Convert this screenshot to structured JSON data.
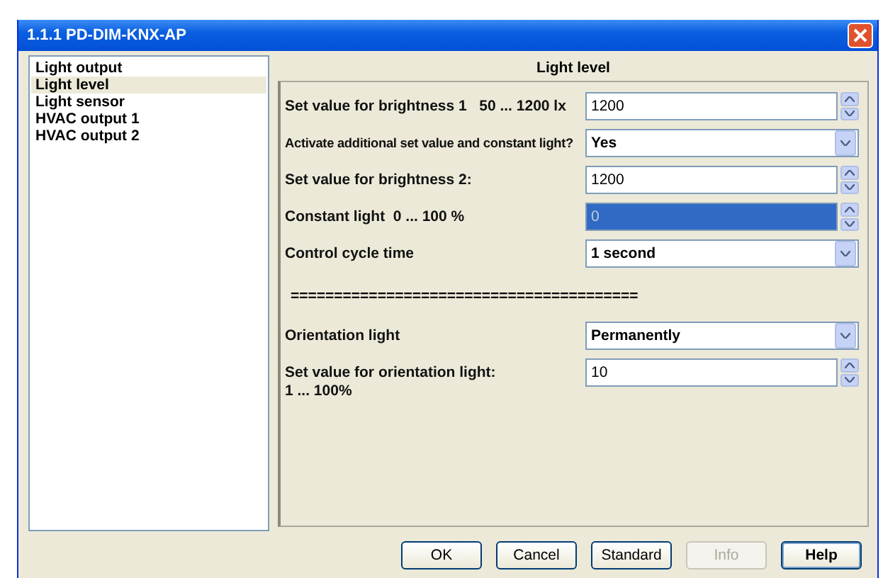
{
  "window": {
    "title": "1.1.1 PD-DIM-KNX-AP"
  },
  "sidebar": {
    "items": [
      {
        "label": "Light output",
        "selected": false
      },
      {
        "label": "Light level",
        "selected": true
      },
      {
        "label": "Light sensor",
        "selected": false
      },
      {
        "label": "HVAC output 1",
        "selected": false
      },
      {
        "label": "HVAC output 2",
        "selected": false
      }
    ]
  },
  "panel": {
    "title": "Light level",
    "parameters": [
      {
        "kind": "spin",
        "label": "Set value for brightness 1   50 ... 1200 lx",
        "value": "1200",
        "selected": false
      },
      {
        "kind": "dropdown",
        "label": "Activate additional set value and constant light?",
        "value": "Yes",
        "selected": false
      },
      {
        "kind": "spin",
        "label": "Set value for brightness 2:",
        "value": "1200",
        "selected": false
      },
      {
        "kind": "spin",
        "label": "Constant light  0 ... 100 %",
        "value": "0",
        "selected": true
      },
      {
        "kind": "dropdown",
        "label": "Control cycle time",
        "value": "1 second",
        "selected": false
      },
      {
        "kind": "separator",
        "label": "========================================"
      },
      {
        "kind": "dropdown",
        "label": "Orientation light",
        "value": "Permanently",
        "selected": false
      },
      {
        "kind": "spin",
        "label": "Set value for orientation light:\n1 ... 100%",
        "value": "10",
        "selected": false
      }
    ]
  },
  "buttons": [
    {
      "label": "OK",
      "disabled": false,
      "default": false
    },
    {
      "label": "Cancel",
      "disabled": false,
      "default": false
    },
    {
      "label": "Standard",
      "disabled": false,
      "default": false
    },
    {
      "label": "Info",
      "disabled": true,
      "default": false
    },
    {
      "label": "Help",
      "disabled": false,
      "default": true
    }
  ]
}
